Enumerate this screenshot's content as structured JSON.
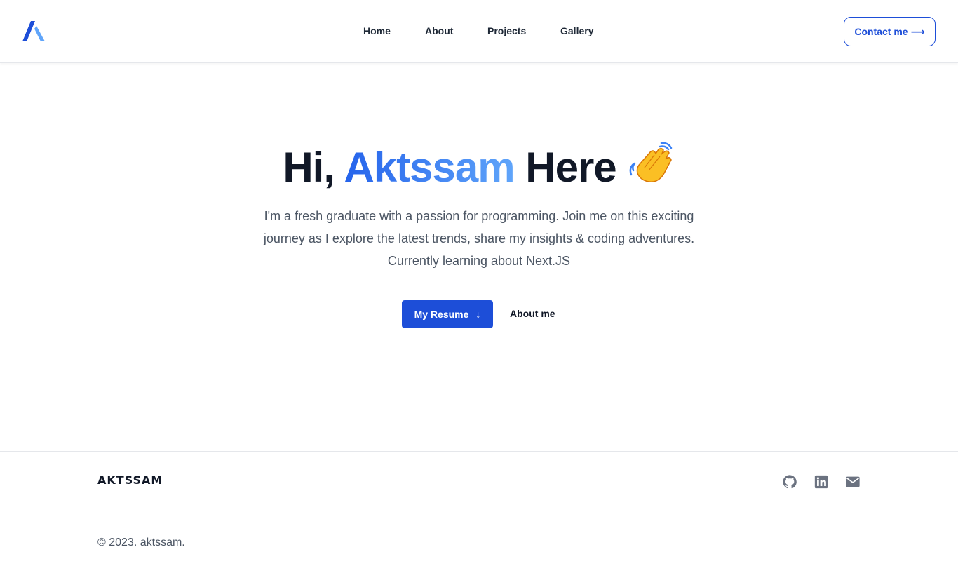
{
  "header": {
    "nav": [
      "Home",
      "About",
      "Projects",
      "Gallery"
    ],
    "contact_label": "Contact me",
    "contact_arrow": "⟶"
  },
  "hero": {
    "title_pre": "Hi, ",
    "title_name": "Aktssam",
    "title_post": " Here",
    "subtitle_lines": [
      "I'm a fresh graduate with a passion for programming. Join me on this exciting",
      "journey as I explore the latest trends, share my insights & coding adventures.",
      "Currently learning about Next.JS"
    ],
    "resume_label": "My Resume",
    "resume_arrow": "↓",
    "about_label": "About me"
  },
  "footer": {
    "logo_text": "AKTSSAM",
    "social_icons": [
      "github-icon",
      "linkedin-icon",
      "mail-icon"
    ],
    "copyright": "© 2023. aktssam."
  },
  "colors": {
    "accent": "#1d4ed8",
    "gradient_start": "#2563eb",
    "gradient_end": "#60a5fa",
    "text_dark": "#111827",
    "text_muted": "#4b5563",
    "icon_gray": "#6b7280"
  }
}
